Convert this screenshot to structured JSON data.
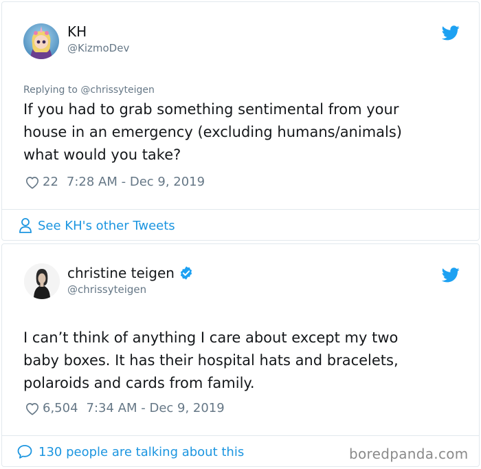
{
  "tweet1": {
    "name": "KH",
    "handle": "@KizmoDev",
    "replying_to": "Replying to @chrissyteigen",
    "text": "If you had to grab something sentimental from your\nhouse in an emergency (excluding humans/animals)\nwhat would you take?",
    "likes": "22",
    "timestamp": "7:28 AM - Dec 9, 2019",
    "footer_link": "See KH's other Tweets"
  },
  "tweet2": {
    "name": "christine teigen",
    "handle": "@chrissyteigen",
    "text": "I can’t think of anything I care about except my two\nbaby boxes. It has their hospital hats and bracelets,\npolaroids and cards from family.",
    "likes": "6,504",
    "timestamp": "7:34 AM - Dec 9, 2019",
    "footer_link": "130 people are talking about this"
  },
  "watermark": "boredpanda.com",
  "colors": {
    "twitter_blue": "#1da1f2",
    "link_blue": "#1b95e0",
    "secondary_text": "#657786",
    "border": "#e1e8ed"
  },
  "icons": [
    "twitter-bird-icon",
    "heart-icon",
    "person-icon",
    "verified-badge-icon",
    "speech-bubble-icon"
  ]
}
